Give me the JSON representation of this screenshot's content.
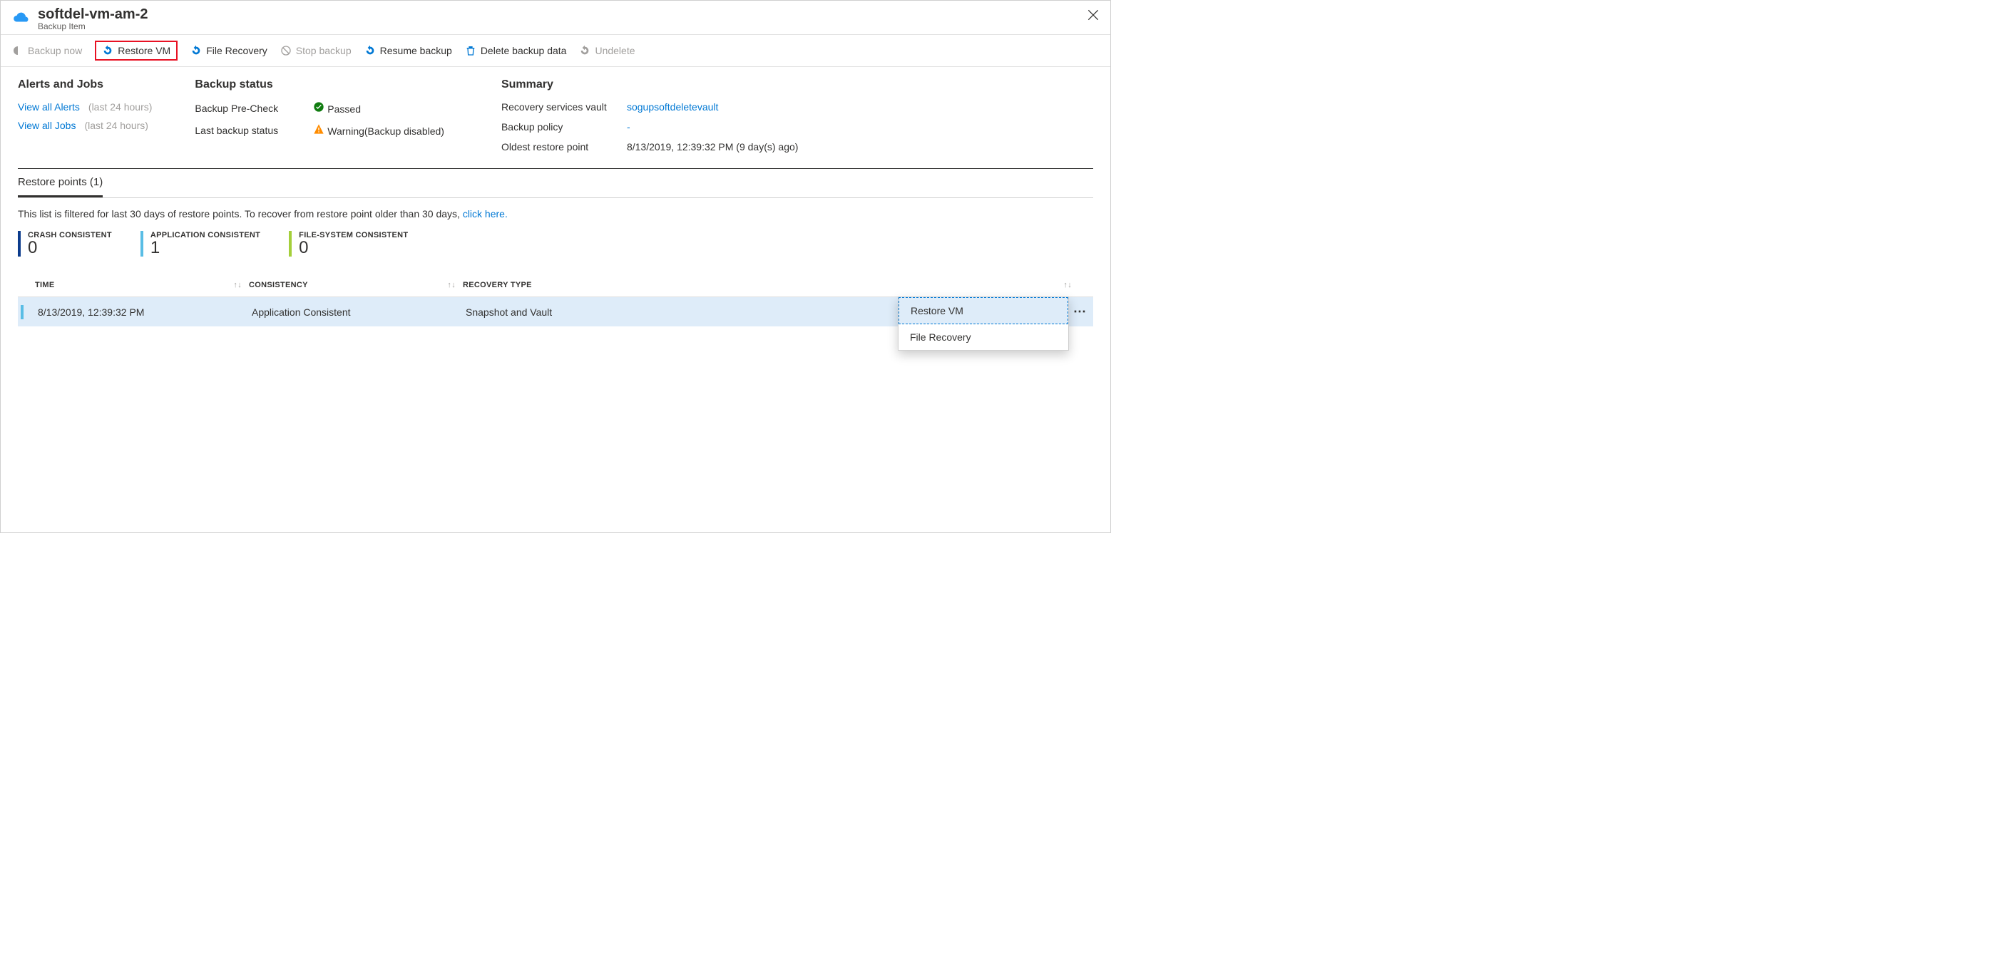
{
  "header": {
    "title": "softdel-vm-am-2",
    "subtitle": "Backup Item"
  },
  "toolbar": {
    "backup_now": "Backup now",
    "restore_vm": "Restore VM",
    "file_recovery": "File Recovery",
    "stop_backup": "Stop backup",
    "resume_backup": "Resume backup",
    "delete_backup": "Delete backup data",
    "undelete": "Undelete"
  },
  "alerts": {
    "heading": "Alerts and Jobs",
    "view_alerts": "View all Alerts",
    "alerts_suffix": "(last 24 hours)",
    "view_jobs": "View all Jobs",
    "jobs_suffix": "(last 24 hours)"
  },
  "backup_status": {
    "heading": "Backup status",
    "precheck_label": "Backup Pre-Check",
    "precheck_value": "Passed",
    "last_status_label": "Last backup status",
    "last_status_value": "Warning(Backup disabled)"
  },
  "summary": {
    "heading": "Summary",
    "vault_label": "Recovery services vault",
    "vault_value": "sogupsoftdeletevault",
    "policy_label": "Backup policy",
    "policy_value": "-",
    "oldest_label": "Oldest restore point",
    "oldest_value": "8/13/2019, 12:39:32 PM (9 day(s) ago)"
  },
  "tabs": {
    "restore_points": "Restore points (1)"
  },
  "filter": {
    "text_prefix": "This list is filtered for last 30 days of restore points. To recover from restore point older than 30 days, ",
    "link": "click here.",
    "text_suffix": ""
  },
  "counters": {
    "crash_label": "CRASH CONSISTENT",
    "crash_value": "0",
    "app_label": "APPLICATION CONSISTENT",
    "app_value": "1",
    "fs_label": "FILE-SYSTEM CONSISTENT",
    "fs_value": "0"
  },
  "table": {
    "headers": {
      "time": "TIME",
      "consistency": "CONSISTENCY",
      "recovery_type": "RECOVERY TYPE"
    },
    "rows": [
      {
        "time": "8/13/2019, 12:39:32 PM",
        "consistency": "Application Consistent",
        "recovery_type": "Snapshot and Vault"
      }
    ]
  },
  "context_menu": {
    "restore_vm": "Restore VM",
    "file_recovery": "File Recovery"
  }
}
